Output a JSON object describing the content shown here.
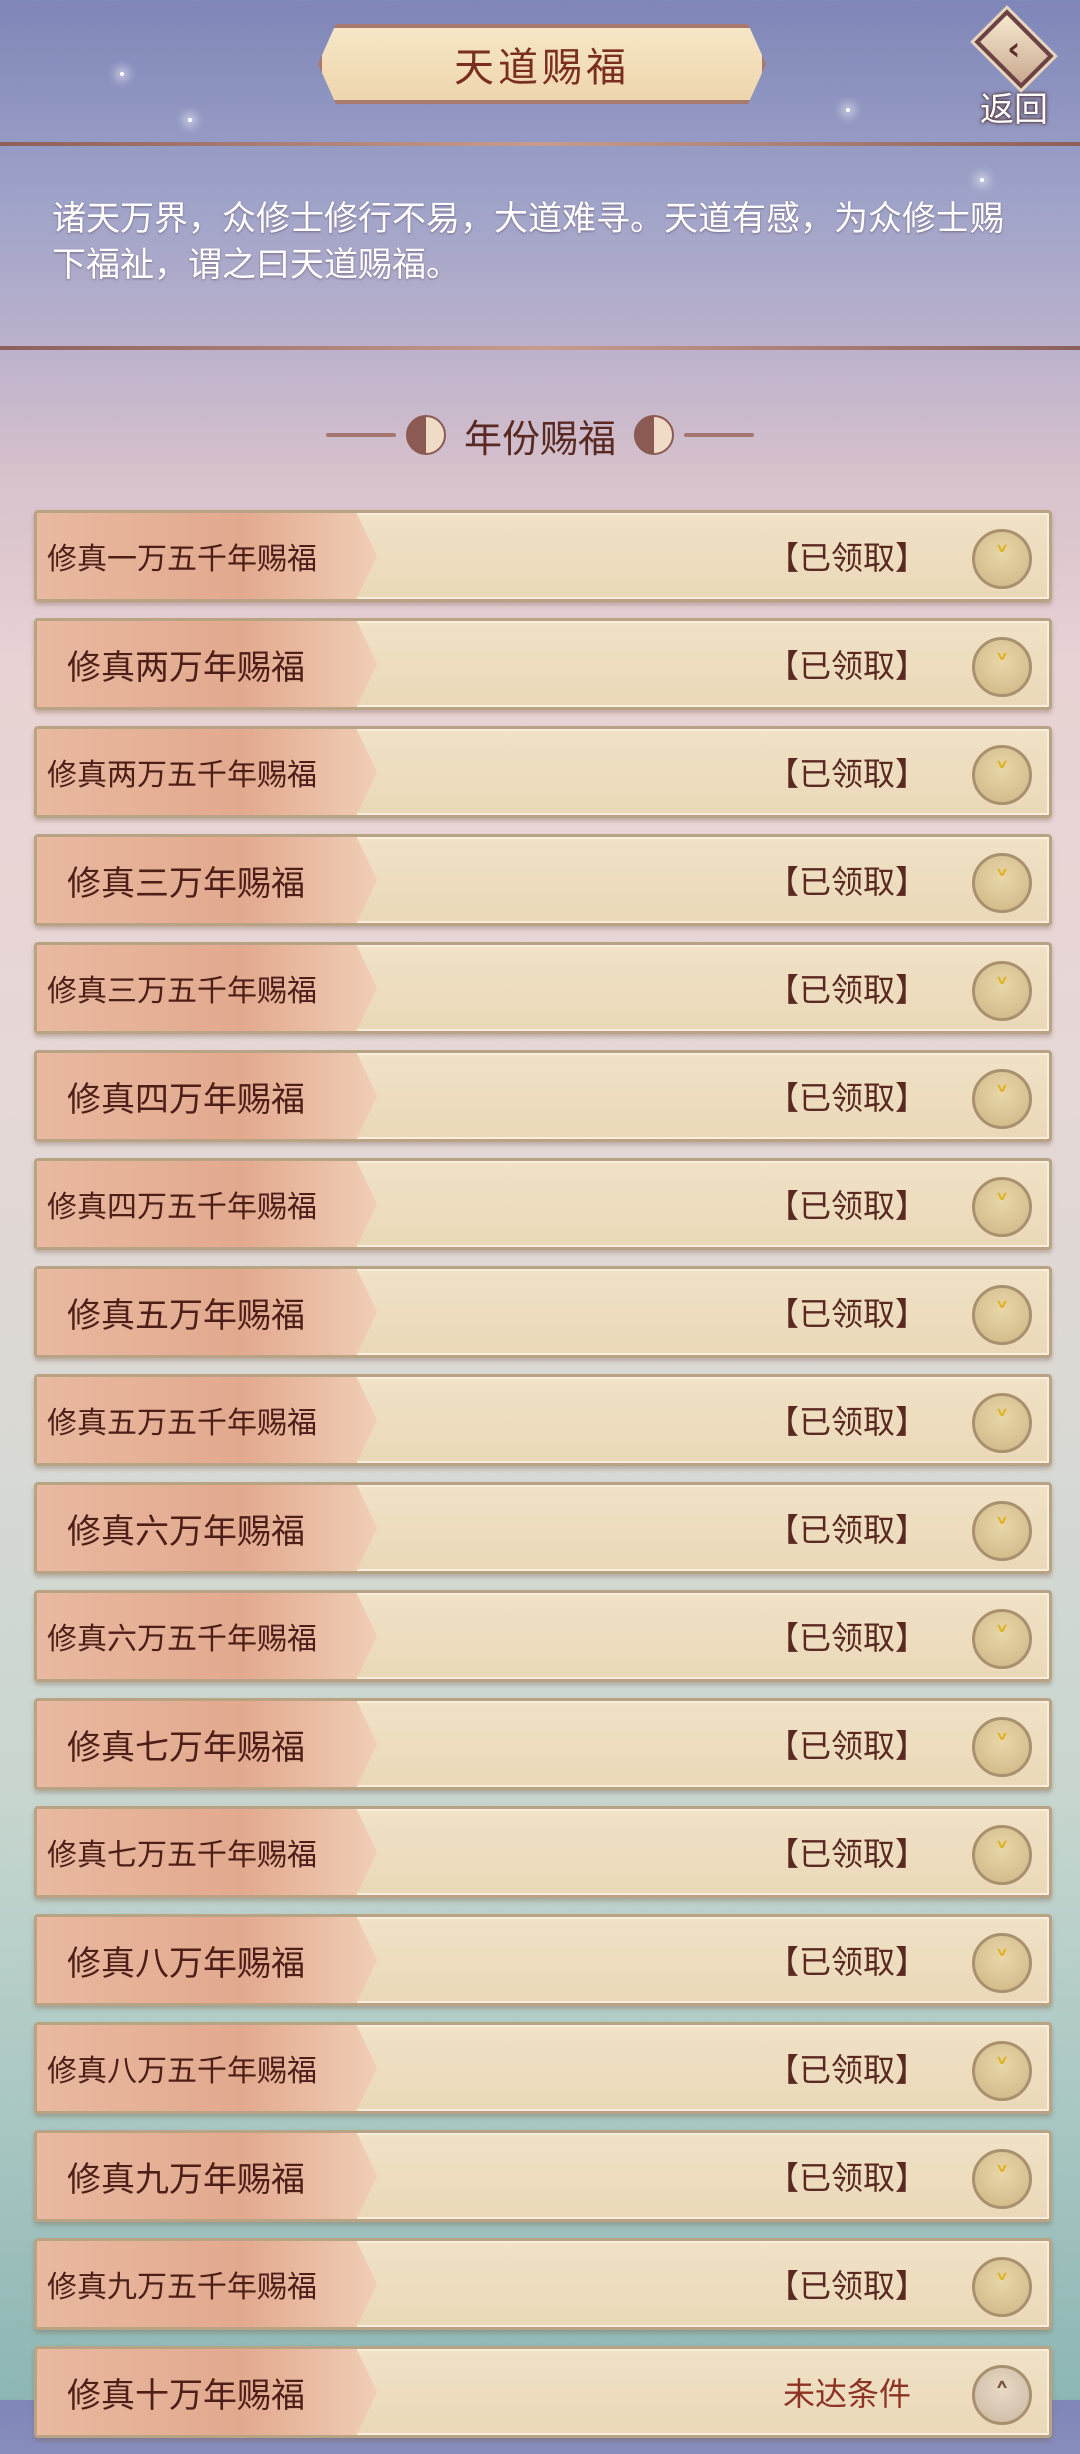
{
  "header": {
    "title": "天道赐福",
    "back_label": "返回",
    "back_icon": "back-arrow-icon"
  },
  "intro_text": "诸天万界，众修士修行不易，大道难寻。天道有感，为众修士赐下福祉，谓之曰天道赐福。",
  "section": {
    "title": "年份赐福",
    "ornament_icon": "yin-yang-icon"
  },
  "rewards": [
    {
      "label": "修真一万五千年赐福",
      "status": "【已领取】",
      "icon": "chevron-down-icon"
    },
    {
      "label": "修真两万年赐福",
      "status": "【已领取】",
      "icon": "chevron-down-icon"
    },
    {
      "label": "修真两万五千年赐福",
      "status": "【已领取】",
      "icon": "chevron-down-icon"
    },
    {
      "label": "修真三万年赐福",
      "status": "【已领取】",
      "icon": "chevron-down-icon"
    },
    {
      "label": "修真三万五千年赐福",
      "status": "【已领取】",
      "icon": "chevron-down-icon"
    },
    {
      "label": "修真四万年赐福",
      "status": "【已领取】",
      "icon": "chevron-down-icon"
    },
    {
      "label": "修真四万五千年赐福",
      "status": "【已领取】",
      "icon": "chevron-down-icon"
    },
    {
      "label": "修真五万年赐福",
      "status": "【已领取】",
      "icon": "chevron-down-icon"
    },
    {
      "label": "修真五万五千年赐福",
      "status": "【已领取】",
      "icon": "chevron-down-icon"
    },
    {
      "label": "修真六万年赐福",
      "status": "【已领取】",
      "icon": "chevron-down-icon"
    },
    {
      "label": "修真六万五千年赐福",
      "status": "【已领取】",
      "icon": "chevron-down-icon"
    },
    {
      "label": "修真七万年赐福",
      "status": "【已领取】",
      "icon": "chevron-down-icon"
    },
    {
      "label": "修真七万五千年赐福",
      "status": "【已领取】",
      "icon": "chevron-down-icon"
    },
    {
      "label": "修真八万年赐福",
      "status": "【已领取】",
      "icon": "chevron-down-icon"
    },
    {
      "label": "修真八万五千年赐福",
      "status": "【已领取】",
      "icon": "chevron-down-icon"
    },
    {
      "label": "修真九万年赐福",
      "status": "【已领取】",
      "icon": "chevron-down-icon"
    },
    {
      "label": "修真九万五千年赐福",
      "status": "【已领取】",
      "icon": "chevron-down-icon"
    },
    {
      "label": "修真十万年赐福",
      "status": "未达条件",
      "icon": "chevron-up-icon"
    }
  ],
  "colors": {
    "accent": "#7a2d21",
    "claimed_icon": "#e0b42a",
    "pending_status": "#8d3325"
  }
}
